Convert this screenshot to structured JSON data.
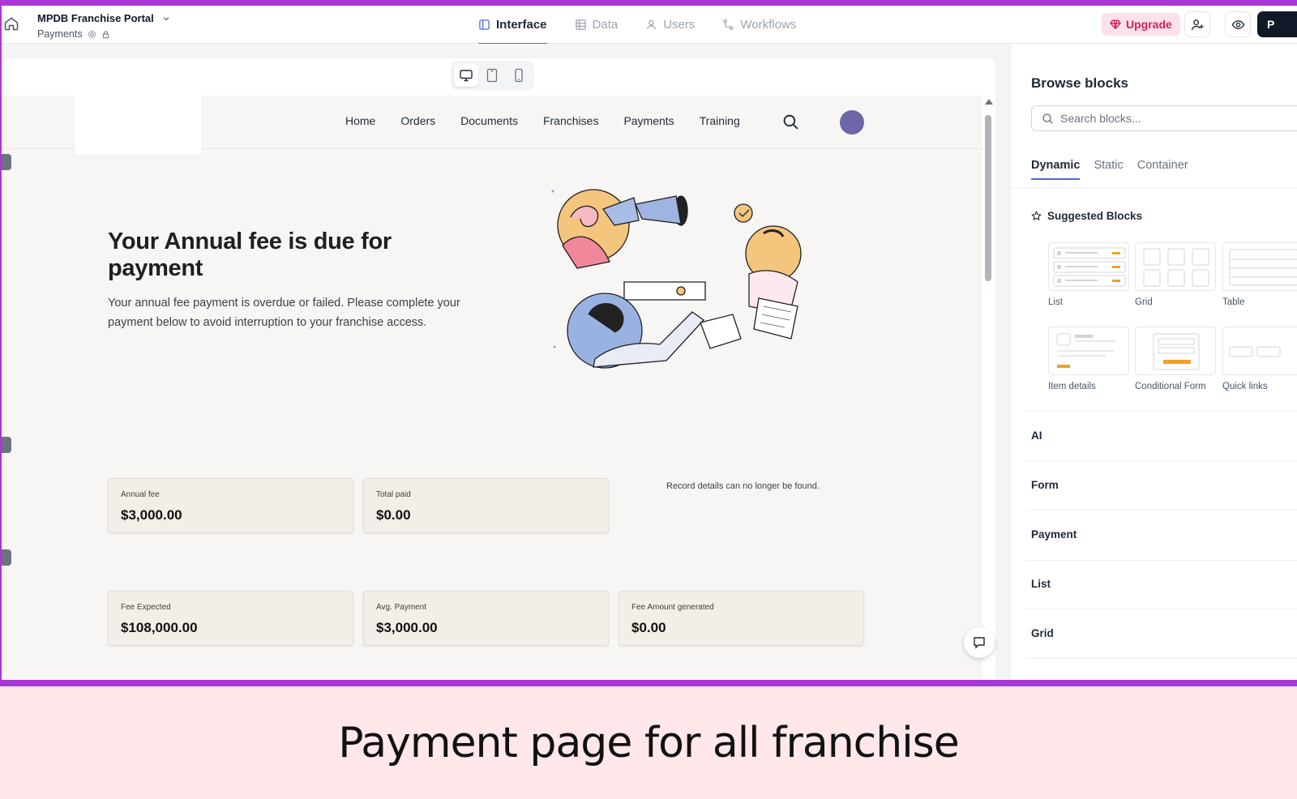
{
  "app": {
    "title": "MPDB Franchise Portal",
    "page_name": "Payments"
  },
  "top_tabs": [
    {
      "label": "Interface",
      "active": true,
      "icon": "layout-icon"
    },
    {
      "label": "Data",
      "active": false,
      "icon": "table-icon"
    },
    {
      "label": "Users",
      "active": false,
      "icon": "user-icon"
    },
    {
      "label": "Workflows",
      "active": false,
      "icon": "workflow-icon"
    }
  ],
  "toolbar": {
    "upgrade_label": "Upgrade",
    "publish_label": "P"
  },
  "site_nav": {
    "links": [
      "Home",
      "Orders",
      "Documents",
      "Franchises",
      "Payments",
      "Training"
    ]
  },
  "hero": {
    "title": "Your Annual fee is due for payment",
    "description": "Your annual fee payment is overdue or failed. Please complete your payment below to avoid interruption to your franchise access."
  },
  "stats_row1": [
    {
      "label": "Annual fee",
      "value": "$3,000.00"
    },
    {
      "label": "Total paid",
      "value": "$0.00"
    }
  ],
  "record_message": "Record details can no longer be found.",
  "stats_row2": [
    {
      "label": "Fee Expected",
      "value": "$108,000.00"
    },
    {
      "label": "Avg. Payment",
      "value": "$3,000.00"
    },
    {
      "label": "Fee Amount generated",
      "value": "$0.00"
    }
  ],
  "panel": {
    "title": "Browse blocks",
    "search_placeholder": "Search blocks...",
    "tabs": [
      {
        "label": "Dynamic",
        "active": true
      },
      {
        "label": "Static",
        "active": false
      },
      {
        "label": "Container",
        "active": false
      }
    ],
    "suggested_title": "Suggested Blocks",
    "blocks": [
      "List",
      "Grid",
      "Table",
      "Item details",
      "Conditional Form",
      "Quick links"
    ],
    "sections": [
      "AI",
      "Form",
      "Payment",
      "List",
      "Grid"
    ]
  },
  "caption": "Payment page for all franchise",
  "colors": {
    "frame": "#a936d6",
    "accent": "#4f6bd8",
    "upgrade": "#d21f5f",
    "avatar": "#6b67a8"
  }
}
